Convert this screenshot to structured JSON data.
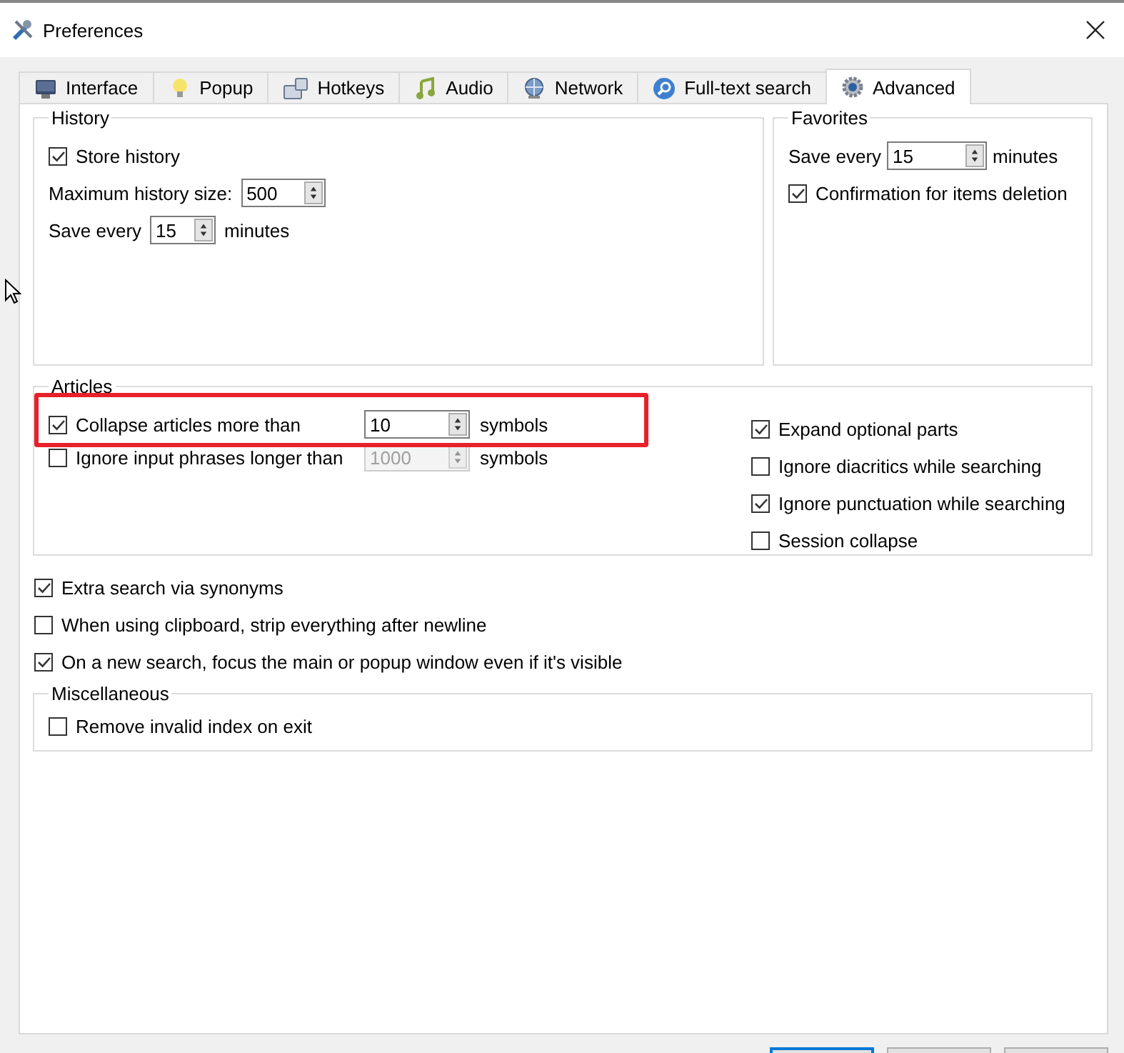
{
  "window": {
    "title": "Preferences"
  },
  "tabs": [
    {
      "label": "Interface",
      "selected": false
    },
    {
      "label": "Popup",
      "selected": false
    },
    {
      "label": "Hotkeys",
      "selected": false
    },
    {
      "label": "Audio",
      "selected": false
    },
    {
      "label": "Network",
      "selected": false
    },
    {
      "label": "Full-text search",
      "selected": false
    },
    {
      "label": "Advanced",
      "selected": true
    }
  ],
  "history": {
    "title": "History",
    "store_history": {
      "label": "Store history",
      "checked": true
    },
    "max_size": {
      "label": "Maximum history size:",
      "value": "500",
      "disabled": false
    },
    "save_every": {
      "label": "Save every",
      "value": "15",
      "unit": "minutes",
      "disabled": false
    }
  },
  "favorites": {
    "title": "Favorites",
    "save_every": {
      "label": "Save every",
      "value": "15",
      "unit": "minutes",
      "disabled": false
    },
    "confirm_deletion": {
      "label": "Confirmation for items deletion",
      "checked": true
    }
  },
  "articles": {
    "title": "Articles",
    "limits": [
      {
        "label": "Collapse articles more than",
        "checked": true,
        "value": "10",
        "disabled": false,
        "unit": "symbols",
        "highlighted": true
      },
      {
        "label": "Ignore input phrases longer than",
        "checked": false,
        "value": "1000",
        "disabled": true,
        "unit": "symbols",
        "highlighted": false
      }
    ],
    "options": [
      {
        "label": "Expand optional parts",
        "checked": true
      },
      {
        "label": "Ignore diacritics while searching",
        "checked": false
      },
      {
        "label": "Ignore punctuation while searching",
        "checked": true
      },
      {
        "label": "Session collapse",
        "checked": false
      }
    ]
  },
  "options": [
    {
      "label": "Extra search via synonyms",
      "checked": true
    },
    {
      "label": "When using clipboard, strip everything after newline",
      "checked": false
    },
    {
      "label": "On a new search, focus the main or popup window even if it's visible",
      "checked": true
    }
  ],
  "miscellaneous": {
    "title": "Miscellaneous",
    "options": [
      {
        "label": "Remove invalid index on exit",
        "checked": false
      }
    ]
  },
  "buttons": [
    {
      "focused": true
    },
    {
      "focused": false
    },
    {
      "focused": false
    }
  ]
}
